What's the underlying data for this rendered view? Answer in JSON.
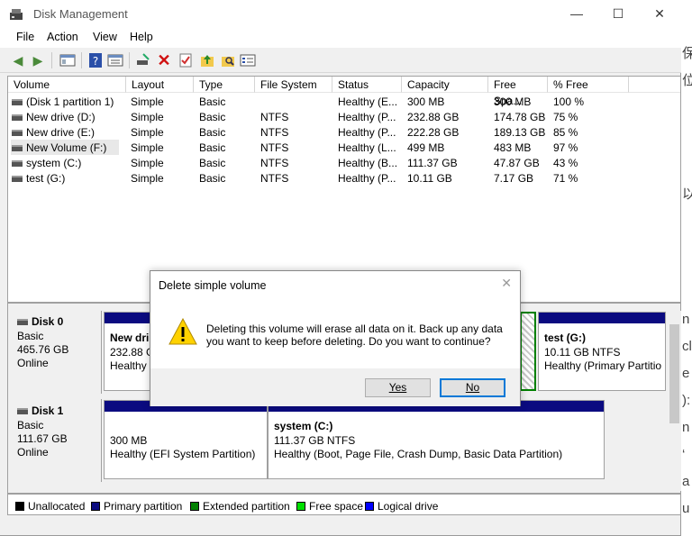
{
  "window": {
    "title": "Disk Management",
    "minimize": "—",
    "maximize": "☐",
    "close": "✕"
  },
  "menu": [
    "File",
    "Action",
    "View",
    "Help"
  ],
  "toolbar": {
    "icons": [
      "back-arrow-icon",
      "forward-arrow-icon",
      "console-tree-icon",
      "help-icon",
      "properties-icon",
      "connect-icon",
      "delete-icon",
      "check-icon",
      "up-folder-icon",
      "search-folder-icon",
      "list-icon"
    ]
  },
  "volumes": {
    "columns": [
      "Volume",
      "Layout",
      "Type",
      "File System",
      "Status",
      "Capacity",
      "Free Spa...",
      "% Free"
    ],
    "rows": [
      [
        "(Disk 1 partition 1)",
        "Simple",
        "Basic",
        "",
        "Healthy (E...",
        "300 MB",
        "300 MB",
        "100 %"
      ],
      [
        "New drive (D:)",
        "Simple",
        "Basic",
        "NTFS",
        "Healthy (P...",
        "232.88 GB",
        "174.78 GB",
        "75 %"
      ],
      [
        "New drive (E:)",
        "Simple",
        "Basic",
        "NTFS",
        "Healthy (P...",
        "222.28 GB",
        "189.13 GB",
        "85 %"
      ],
      [
        "New Volume (F:)",
        "Simple",
        "Basic",
        "NTFS",
        "Healthy (L...",
        "499 MB",
        "483 MB",
        "97 %"
      ],
      [
        "system (C:)",
        "Simple",
        "Basic",
        "NTFS",
        "Healthy (B...",
        "111.37 GB",
        "47.87 GB",
        "43 %"
      ],
      [
        "test (G:)",
        "Simple",
        "Basic",
        "NTFS",
        "Healthy (P...",
        "10.11 GB",
        "7.17 GB",
        "71 %"
      ]
    ]
  },
  "disks": [
    {
      "name": "Disk 0",
      "type": "Basic",
      "size": "465.76 GB",
      "state": "Online",
      "partitions": [
        {
          "title": "New dri",
          "size": "232.88 G",
          "status": "Healthy"
        },
        {
          "title": "test  (G:)",
          "size": "10.11 GB NTFS",
          "status": "Healthy (Primary Partitio"
        }
      ]
    },
    {
      "name": "Disk 1",
      "type": "Basic",
      "size": "111.67 GB",
      "state": "Online",
      "partitions": [
        {
          "title": "",
          "size": "300 MB",
          "status": "Healthy (EFI System Partition)"
        },
        {
          "title": "system  (C:)",
          "size": "111.37 GB NTFS",
          "status": "Healthy (Boot, Page File, Crash Dump, Basic Data Partition)"
        }
      ]
    }
  ],
  "legend": [
    {
      "label": "Unallocated",
      "color": "#000000"
    },
    {
      "label": "Primary partition",
      "color": "#0b0b80"
    },
    {
      "label": "Extended partition",
      "color": "#008000"
    },
    {
      "label": "Free space",
      "color": "#00e000"
    },
    {
      "label": "Logical drive",
      "color": "#0000ff"
    }
  ],
  "dialog": {
    "title": "Delete simple volume",
    "message": "Deleting this volume will erase all data on it. Back up any data you want to keep before deleting. Do you want to continue?",
    "yes": "Yes",
    "no": "No",
    "close": "✕"
  },
  "right_strip": [
    "保",
    "位",
    "以",
    "n",
    "cl",
    "e",
    "):",
    "n",
    "‘",
    "a",
    "u",
    "e"
  ]
}
